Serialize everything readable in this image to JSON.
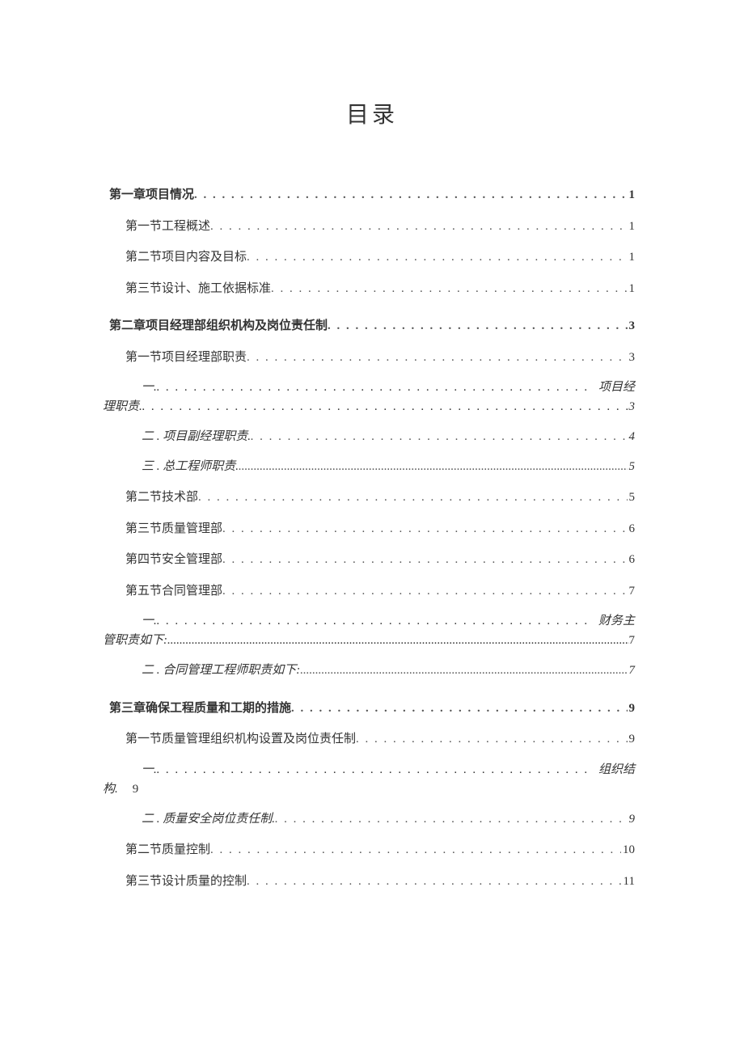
{
  "title": "目录",
  "entries": {
    "ch1": {
      "label": "第一章项目情况",
      "page": "1"
    },
    "ch1s1": {
      "label": "第一节工程概述",
      "page": "1"
    },
    "ch1s2": {
      "label": "第二节项目内容及目标",
      "page": "1"
    },
    "ch1s3": {
      "label": "第三节设计、施工依据标准",
      "page": "1"
    },
    "ch2": {
      "label": "第二章项目经理部组织机构及岗位责任制",
      "page": "3"
    },
    "ch2s1": {
      "label": "第一节项目经理部职责",
      "page": "3"
    },
    "ch2s1i1": {
      "prefix": "一.",
      "trail": "项目经",
      "cont": "理职责.",
      "page": "3"
    },
    "ch2s1i2": {
      "label": "二   . 项目副经理职责.",
      "page": "4"
    },
    "ch2s1i3": {
      "label": "三   . 总工程师职责.",
      "page": "5"
    },
    "ch2s2": {
      "label": "第二节技术部",
      "page": "5"
    },
    "ch2s3": {
      "label": "第三节质量管理部",
      "page": "6"
    },
    "ch2s4": {
      "label": "第四节安全管理部",
      "page": "6"
    },
    "ch2s5": {
      "label": "第五节合同管理部",
      "page": "7"
    },
    "ch2s5i1": {
      "prefix": "一.",
      "trail": "财务主",
      "cont": "管职责如下:",
      "page": "7"
    },
    "ch2s5i2": {
      "label": "二   . 合同管理工程师职责如下:",
      "page": "7"
    },
    "ch3": {
      "label": "第三章确保工程质量和工期的措施",
      "page": "9"
    },
    "ch3s1": {
      "label": "第一节质量管理组织机构设置及岗位责任制",
      "page": "9"
    },
    "ch3s1i1": {
      "prefix": "一.",
      "trail": "组织结",
      "cont": "构.",
      "page": "9"
    },
    "ch3s1i2": {
      "label": "二   . 质量安全岗位责任制.",
      "page": "9"
    },
    "ch3s2": {
      "label": "第二节质量控制",
      "page": "10"
    },
    "ch3s3": {
      "label": "第三节设计质量的控制",
      "page": "11"
    }
  }
}
